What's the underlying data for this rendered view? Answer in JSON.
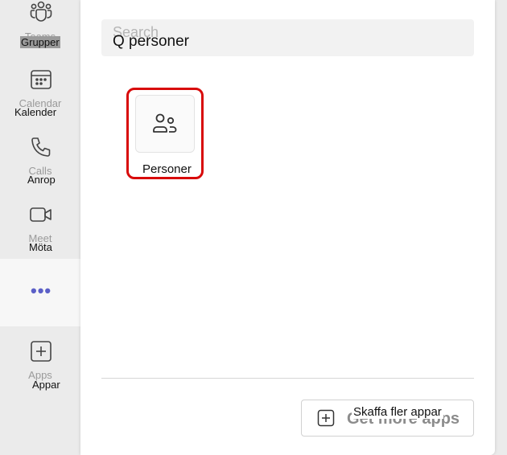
{
  "rail": {
    "teams": {
      "ghost": "Teams",
      "label": "Grupper"
    },
    "calendar": {
      "ghost": "Calendar",
      "label": "Kalender"
    },
    "calls": {
      "ghost": "Calls",
      "label": "Anrop"
    },
    "meet": {
      "ghost": "Meet",
      "label": "Möta"
    },
    "more": {
      "label": "•••"
    },
    "apps": {
      "ghost": "Apps",
      "label": "Appar"
    }
  },
  "search": {
    "ghost": "Search",
    "q": "Q",
    "value": "personer"
  },
  "app": {
    "label": "Personer",
    "icon": "people-icon"
  },
  "get_more": {
    "ghost": "Get more apps",
    "label": "Skaffa fler appar"
  },
  "colors": {
    "accent": "#5b5fc7",
    "highlight": "#d80a0a"
  }
}
